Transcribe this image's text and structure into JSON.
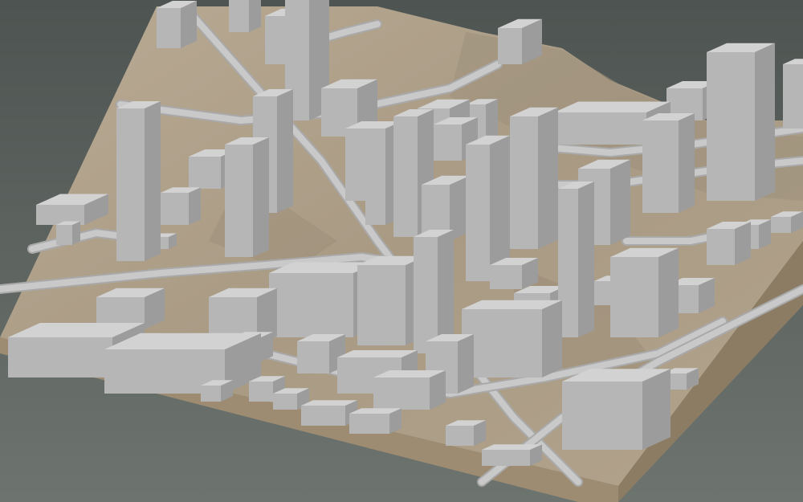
{
  "scene": {
    "subject": "isometric-city-3d-model",
    "colors": {
      "background_top": "#4e5451",
      "background_bottom": "#6d746f",
      "terrain_light": "#b7a791",
      "terrain_mid": "#a49580",
      "terrain_dark": "#8f826f",
      "base_side_left": "#9d8c72",
      "base_side_right": "#8c7c64",
      "road": "#c9c9c9",
      "road_edge": "#a9a9a9",
      "building_top": "#d2d2d2",
      "building_left": "#b6b6b6",
      "building_right": "#9c9c9c"
    }
  }
}
